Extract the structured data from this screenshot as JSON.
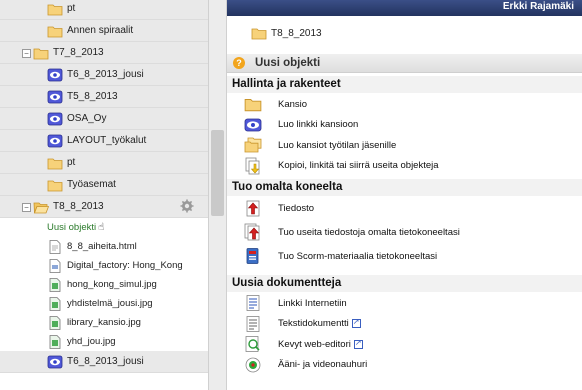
{
  "user_name": "Erkki Rajamäki",
  "breadcrumb": "T8_8_2013",
  "panel": {
    "title": "Uusi objekti",
    "help_icon": "?",
    "sections": [
      {
        "title": "Hallinta ja rakenteet",
        "items": [
          {
            "label": "Kansio",
            "icon": "folder-icon"
          },
          {
            "label": "Luo linkki kansioon",
            "icon": "link-folder-icon"
          },
          {
            "label": "Luo kansiot työtilan jäsenille",
            "icon": "folders-icon"
          },
          {
            "label": "Kopioi, linkitä tai siirrä useita objekteja",
            "icon": "copy-move-icon"
          }
        ]
      },
      {
        "title": "Tuo omalta koneelta",
        "items": [
          {
            "label": "Tiedosto",
            "icon": "upload-file-icon"
          },
          {
            "label": "Tuo useita tiedostoja omalta tietokoneeltasi",
            "icon": "upload-multiple-icon"
          },
          {
            "label": "Tuo Scorm-materiaalia tietokoneeltasi",
            "icon": "scorm-icon"
          }
        ]
      },
      {
        "title": "Uusia dokumentteja",
        "items": [
          {
            "label": "Linkki Internetiin",
            "icon": "web-link-icon"
          },
          {
            "label": "Tekstidokumentti",
            "icon": "text-doc-icon",
            "external": true
          },
          {
            "label": "Kevyt web-editori",
            "icon": "web-editor-icon",
            "external": true
          },
          {
            "label": "Ääni- ja videonauhuri",
            "icon": "recorder-icon"
          }
        ]
      }
    ]
  },
  "tree": {
    "rows": [
      {
        "label": "pt",
        "icon": "folder-icon",
        "style": "band",
        "indent": 47
      },
      {
        "label": "Annen spiraalit",
        "icon": "folder-icon",
        "style": "band",
        "indent": 47
      },
      {
        "label": "T7_8_2013",
        "icon": "folder-icon",
        "style": "band",
        "indent": 33,
        "toggle": "−"
      },
      {
        "label": "T6_8_2013_jousi",
        "icon": "workspace-icon",
        "style": "band",
        "indent": 47
      },
      {
        "label": "T5_8_2013",
        "icon": "workspace-icon",
        "style": "band",
        "indent": 47
      },
      {
        "label": "OSA_Oy",
        "icon": "workspace-icon",
        "style": "band",
        "indent": 47
      },
      {
        "label": "LAYOUT_työkalut",
        "icon": "workspace-icon",
        "style": "band",
        "indent": 47
      },
      {
        "label": "pt",
        "icon": "folder-icon",
        "style": "band",
        "indent": 47
      },
      {
        "label": "Työasemat",
        "icon": "folder-icon",
        "style": "band",
        "indent": 47
      },
      {
        "label": "T8_8_2013",
        "icon": "folder-open-icon",
        "style": "band",
        "indent": 33,
        "toggle": "−",
        "gear": true
      },
      {
        "label": "Uusi objekti",
        "icon": "",
        "style": "sub",
        "indent": 47,
        "selected": true
      },
      {
        "label": "8_8_aiheita.html",
        "icon": "html-file-icon",
        "style": "sub",
        "indent": 47
      },
      {
        "label": "Digital_factory: Hong_Kong",
        "icon": "link-file-icon",
        "style": "sub",
        "indent": 47
      },
      {
        "label": "hong_kong_simul.jpg",
        "icon": "image-file-icon",
        "style": "sub",
        "indent": 47
      },
      {
        "label": "yhdistelmä_jousi.jpg",
        "icon": "image-file-icon",
        "style": "sub",
        "indent": 47
      },
      {
        "label": "library_kansio.jpg",
        "icon": "image-file-icon",
        "style": "sub",
        "indent": 47
      },
      {
        "label": "yhd_jou.jpg",
        "icon": "image-file-icon",
        "style": "sub",
        "indent": 47
      },
      {
        "label": "T6_8_2013_jousi",
        "icon": "workspace-icon",
        "style": "band",
        "indent": 47
      }
    ]
  },
  "colors": {
    "topbar": "#2d3f72",
    "selected_text": "#2a7a2a",
    "tree_band": "#e9e9e9"
  }
}
